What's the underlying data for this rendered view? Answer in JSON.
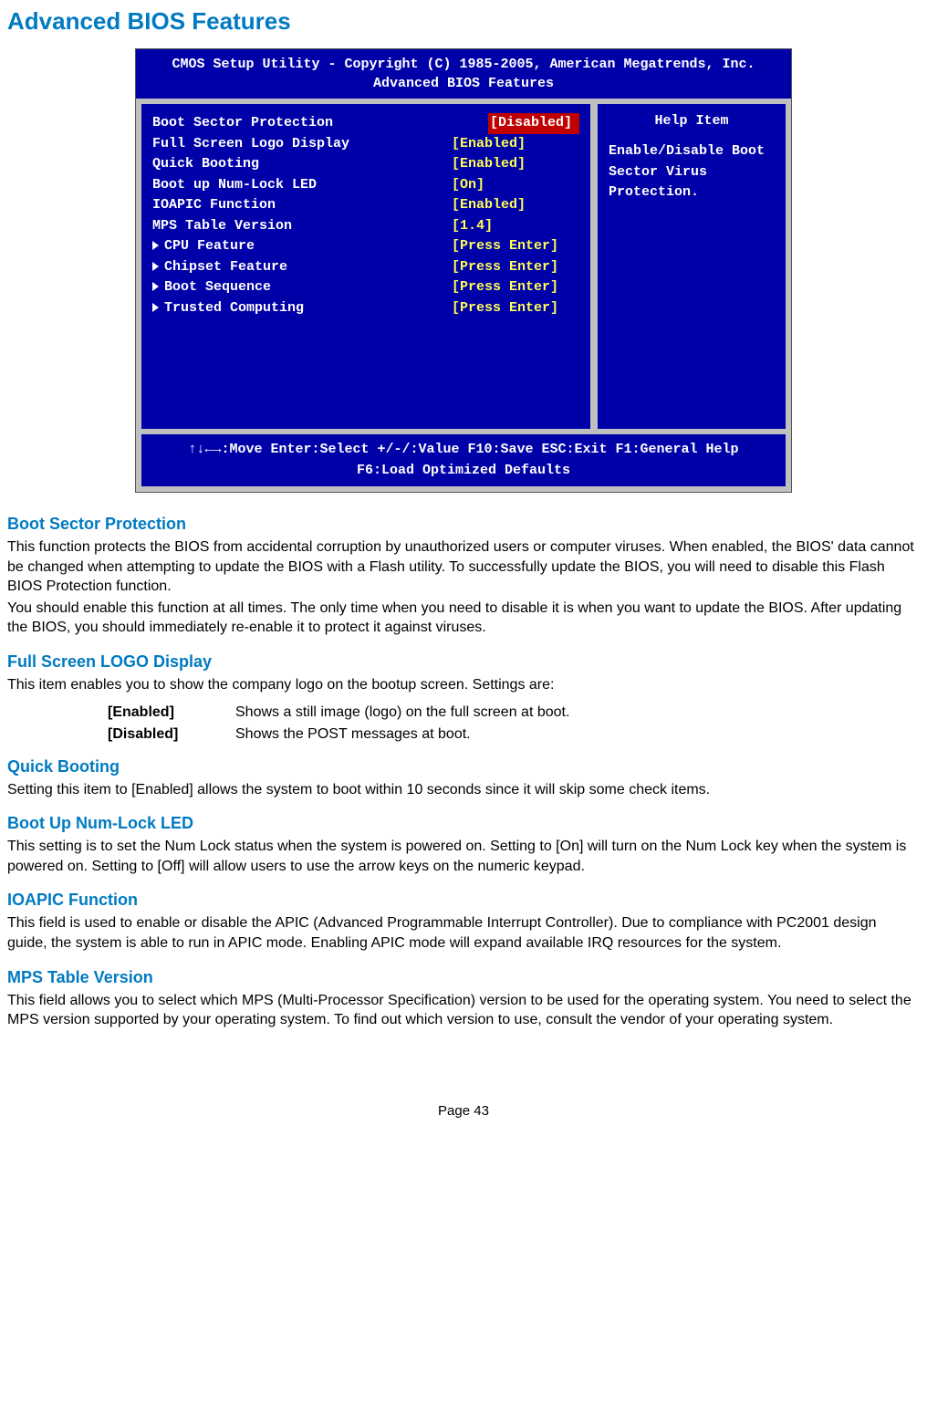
{
  "page_title": "Advanced BIOS Features",
  "bios": {
    "titlebar_line1": "CMOS Setup Utility - Copyright (C) 1985-2005, American Megatrends, Inc.",
    "titlebar_line2": "Advanced BIOS Features",
    "items": [
      {
        "label": "Boot Sector Protection",
        "value": "[Disabled]",
        "selected": true,
        "submenu": false
      },
      {
        "label": "Full Screen Logo Display",
        "value": "[Enabled]",
        "selected": false,
        "submenu": false
      },
      {
        "label": "Quick Booting",
        "value": "[Enabled]",
        "selected": false,
        "submenu": false
      },
      {
        "label": "Boot up Num-Lock LED",
        "value": "[On]",
        "selected": false,
        "submenu": false
      },
      {
        "label": "IOAPIC Function",
        "value": "[Enabled]",
        "selected": false,
        "submenu": false
      },
      {
        "label": "MPS Table Version",
        "value": "[1.4]",
        "selected": false,
        "submenu": false
      },
      {
        "label": "CPU Feature",
        "value": "[Press Enter]",
        "selected": false,
        "submenu": true
      },
      {
        "label": "Chipset Feature",
        "value": "[Press Enter]",
        "selected": false,
        "submenu": true
      },
      {
        "label": "Boot Sequence",
        "value": "[Press Enter]",
        "selected": false,
        "submenu": true
      },
      {
        "label": "Trusted Computing",
        "value": "[Press Enter]",
        "selected": false,
        "submenu": true
      }
    ],
    "help_title": "Help Item",
    "help_text": "Enable/Disable Boot Sector Virus Protection.",
    "footer_line1": "↑↓←→:Move  Enter:Select  +/-/:Value  F10:Save  ESC:Exit  F1:General Help",
    "footer_line2": "F6:Load Optimized Defaults"
  },
  "sections": {
    "boot_sector": {
      "title": "Boot Sector Protection",
      "p1": "This function protects the BIOS from accidental corruption by unauthorized users or computer viruses. When enabled, the BIOS' data cannot be changed when attempting to update the BIOS with a Flash utility. To successfully update the BIOS, you will need to disable this Flash BIOS Protection function.",
      "p2": "You should enable this function at all times. The only time when you need to disable it is when you want to update the BIOS. After updating the BIOS, you should immediately re-enable it to protect it against viruses."
    },
    "full_screen_logo": {
      "title": "Full Screen LOGO Display",
      "p1": "This item enables you to show the company logo on the bootup screen. Settings are:",
      "settings": [
        {
          "key": "[Enabled]",
          "desc": "Shows a still image (logo) on the full screen at boot."
        },
        {
          "key": "[Disabled]",
          "desc": "Shows the POST messages at boot."
        }
      ]
    },
    "quick_booting": {
      "title": "Quick Booting",
      "p1": "Setting this item to [Enabled] allows the system to boot within 10 seconds since it will skip some check items."
    },
    "numlock": {
      "title": "Boot Up Num-Lock LED",
      "p1": "This setting is to set the Num Lock status when the system is powered on. Setting to [On] will turn on the Num Lock key when the system is powered on. Setting to [Off] will allow users to use the arrow keys on the numeric keypad."
    },
    "ioapic": {
      "title": "IOAPIC Function",
      "p1": "This field is used to enable or disable the APIC (Advanced Programmable Interrupt Controller). Due to compliance with PC2001 design guide, the system is able to run in APIC mode. Enabling APIC mode will expand available IRQ resources for the system."
    },
    "mps": {
      "title": "MPS Table Version",
      "p1": "This field allows you to select which MPS (Multi-Processor Specification) version to be used for the operating system. You need to select the MPS version supported by your operating system. To find out which version to use, consult the vendor of your operating system."
    }
  },
  "page_number": "Page 43"
}
